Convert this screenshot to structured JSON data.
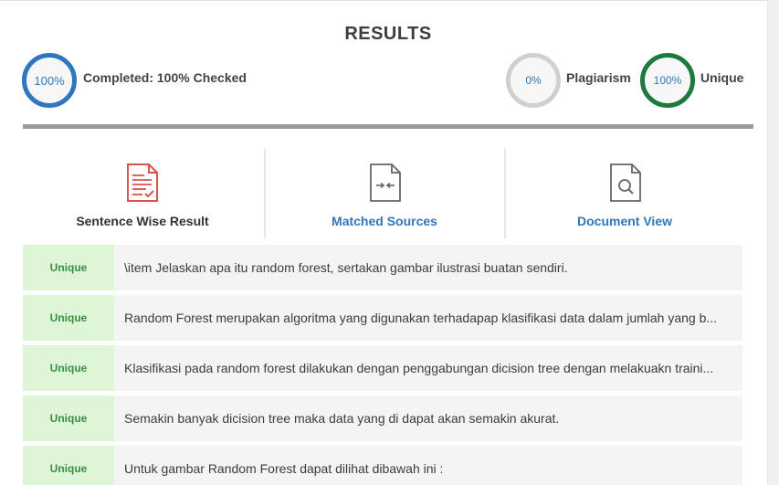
{
  "header": {
    "title": "RESULTS"
  },
  "stats": {
    "completed_value": "100%",
    "completed_label": "Completed: 100% Checked",
    "plagiarism_value": "0%",
    "plagiarism_label": "Plagiarism",
    "unique_value": "100%",
    "unique_label": "Unique",
    "colors": {
      "completed": "#2f77bd",
      "plagiarism": "#d0d0d0",
      "unique": "#1c7a3e"
    }
  },
  "tabs": [
    {
      "label": "Sentence Wise Result",
      "icon": "document-check-icon"
    },
    {
      "label": "Matched Sources",
      "icon": "document-arrows-icon"
    },
    {
      "label": "Document View",
      "icon": "document-search-icon"
    }
  ],
  "results": [
    {
      "status": "Unique",
      "text": "\\item Jelaskan apa itu random forest, sertakan gambar ilustrasi buatan sendiri."
    },
    {
      "status": "Unique",
      "text": "Random Forest merupakan algoritma yang digunakan terhadapap klasifikasi data dalam jumlah yang b..."
    },
    {
      "status": "Unique",
      "text": "Klasifikasi pada random forest dilakukan dengan penggabungan dicision tree dengan melakuakn traini..."
    },
    {
      "status": "Unique",
      "text": "Semakin banyak dicision tree maka data yang di dapat akan semakin akurat."
    },
    {
      "status": "Unique",
      "text": "Untuk gambar Random Forest dapat dilihat dibawah ini :"
    }
  ]
}
